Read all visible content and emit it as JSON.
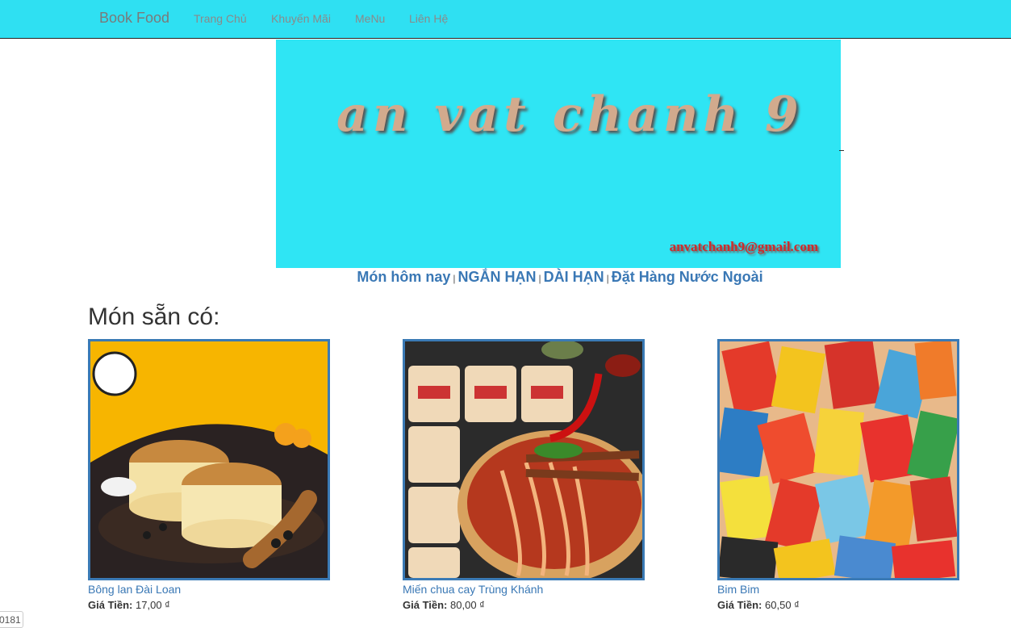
{
  "navbar": {
    "brand": "Book Food",
    "links": [
      "Trang Chủ",
      "Khuyến Mãi",
      "MeNu",
      "Liên Hệ"
    ]
  },
  "banner": {
    "title": "an vat chanh 9",
    "email": "anvatchanh9@gmail.com"
  },
  "categories": [
    "Món hôm nay",
    "NGẮN HẠN",
    "DÀI HẠN",
    "Đặt Hàng Nước Ngoài"
  ],
  "separator": "|",
  "section_title": "Món sẵn có:",
  "price_label": "Giá Tiền:",
  "products": [
    {
      "name": "Bông lan Đài Loan",
      "price": "17,00 ₫"
    },
    {
      "name": "Miến chua cay Trùng Khánh",
      "price": "80,00 ₫"
    },
    {
      "name": "Bim Bim",
      "price": "60,50 ₫"
    }
  ],
  "corner_tag": "0181",
  "colors": {
    "navbar": "#2fe0f2",
    "banner": "#2fe5f4",
    "link": "#3a78b5",
    "image_border": "#3a7ab5"
  }
}
